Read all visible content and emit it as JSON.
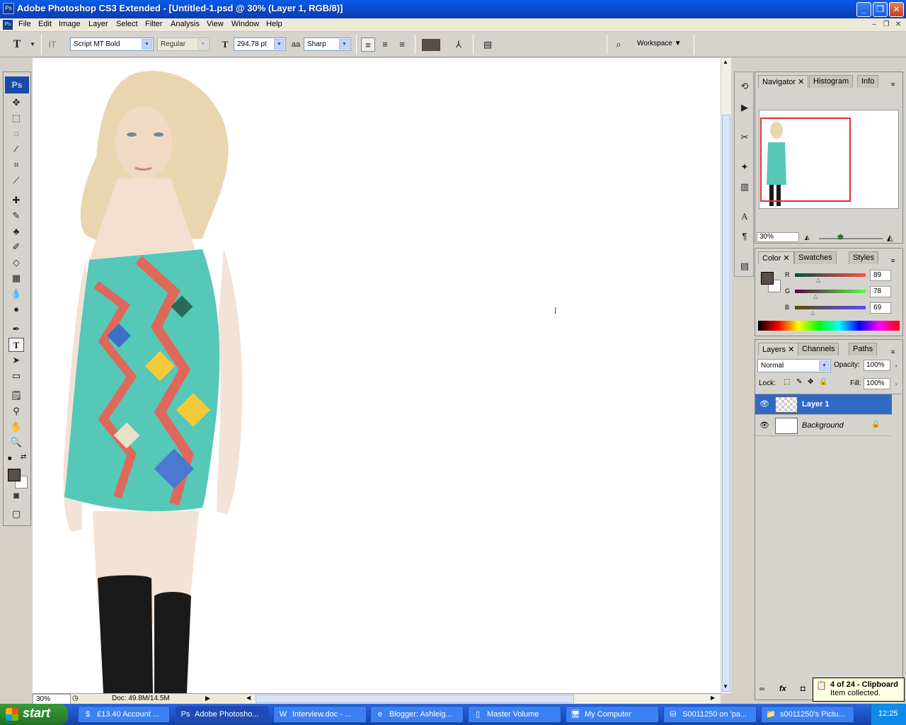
{
  "window": {
    "title": "Adobe Photoshop CS3 Extended - [Untitled-1.psd @ 30% (Layer 1, RGB/8)]",
    "app_icon": "Ps",
    "minimize": "_",
    "maximize": "❐",
    "close": "✕"
  },
  "menu": [
    "File",
    "Edit",
    "Image",
    "Layer",
    "Select",
    "Filter",
    "Analysis",
    "View",
    "Window",
    "Help"
  ],
  "options": {
    "font_family": "Script MT Bold",
    "font_style": "Regular",
    "font_size": "294.78 pt",
    "antialias": "Sharp",
    "text_color": "#594e45",
    "workspace": "Workspace ▼"
  },
  "toolbox": {
    "logo": "Ps",
    "fg_color": "#594e45",
    "bg_color": "#ffffff"
  },
  "status": {
    "zoom": "30%",
    "doc": "Doc: 49.8M/14.5M"
  },
  "navigator": {
    "tabs": [
      "Navigator",
      "Histogram",
      "Info"
    ],
    "zoom": "30%"
  },
  "color_panel": {
    "tabs": [
      "Color",
      "Swatches",
      "Styles"
    ],
    "r_label": "R",
    "g_label": "G",
    "b_label": "B",
    "r": "89",
    "g": "78",
    "b": "69"
  },
  "layers_panel": {
    "tabs": [
      "Layers",
      "Channels",
      "Paths"
    ],
    "blend_mode": "Normal",
    "opacity_label": "Opacity:",
    "opacity": "100%",
    "lock_label": "Lock:",
    "fill_label": "Fill:",
    "fill": "100%",
    "layers": [
      {
        "name": "Layer 1",
        "selected": true
      },
      {
        "name": "Background",
        "selected": false
      }
    ]
  },
  "clipboard": {
    "title": "4 of 24 - Clipboard",
    "message": "Item collected."
  },
  "taskbar": {
    "start": "start",
    "tasks": [
      "£13.40 Account ...",
      "Adobe Photosho...",
      "Interview.doc - ...",
      "Blogger: Ashleig...",
      "Master Volume",
      "My Computer",
      "S0011250 on 'pa...",
      "s0011250's Pictu..."
    ],
    "clock": "12:25"
  }
}
